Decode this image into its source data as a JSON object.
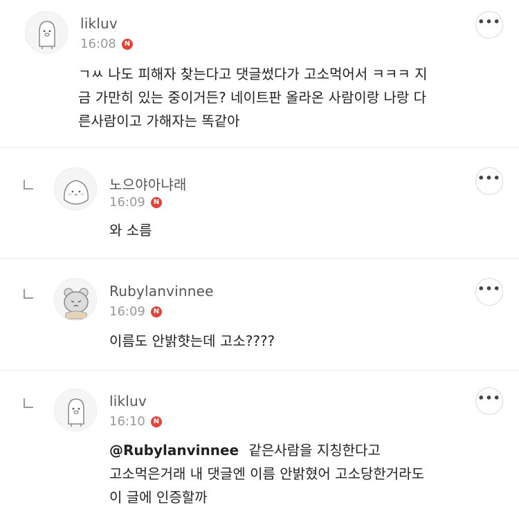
{
  "comments": [
    {
      "username": "likluv",
      "time": "16:08",
      "badge": "N",
      "more": "•••",
      "lines": [
        "ㄱㅆ 나도 피해자 찾는다고 댓글썼다가 고소먹어서 ㅋㅋㅋ 지",
        "금 가만히 있는 중이거든? 네이트판 올라온 사람이랑 나랑 다",
        "른사람이고 가해자는 똑같아"
      ]
    },
    {
      "username": "노으야아냐래",
      "time": "16:09",
      "badge": "N",
      "more": "•••",
      "lines": [
        "와 소름"
      ]
    },
    {
      "username": "Rubylanvinnee",
      "time": "16:09",
      "badge": "N",
      "more": "•••",
      "lines": [
        "이름도 안밝햣는데 고소????"
      ]
    },
    {
      "username": "likluv",
      "time": "16:10",
      "badge": "N",
      "more": "•••",
      "mention": "@Rubylanvinnee",
      "first_line_rest": "같은사람을 지칭한다고",
      "lines": [
        "고소먹은거래 내 댓글엔 이름 안밝혔어 고소당한거라도",
        "이 글에 인증할까"
      ]
    }
  ]
}
